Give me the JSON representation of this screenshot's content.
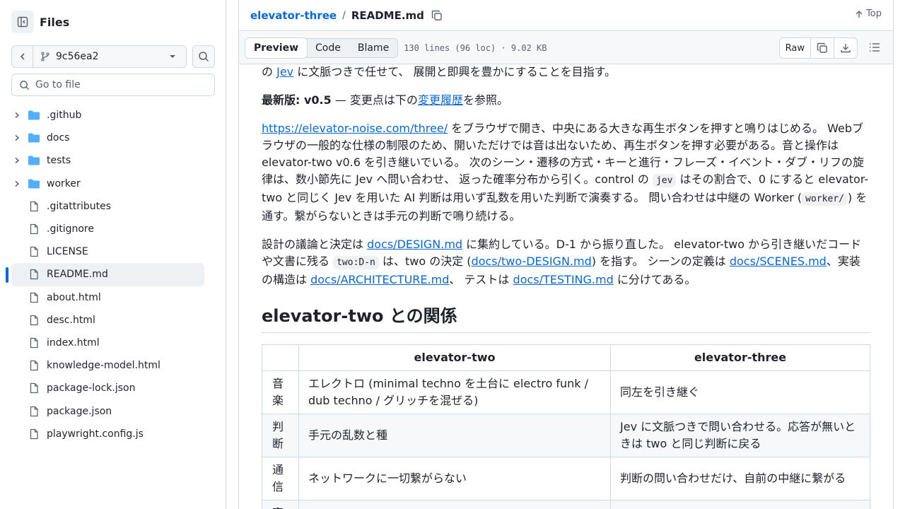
{
  "sidebar": {
    "title": "Files",
    "branch": "9c56ea2",
    "goto_placeholder": "Go to file",
    "items": [
      {
        "type": "dir",
        "label": ".github"
      },
      {
        "type": "dir",
        "label": "docs"
      },
      {
        "type": "dir",
        "label": "tests"
      },
      {
        "type": "dir",
        "label": "worker"
      },
      {
        "type": "file",
        "label": ".gitattributes"
      },
      {
        "type": "file",
        "label": ".gitignore"
      },
      {
        "type": "file",
        "label": "LICENSE"
      },
      {
        "type": "file",
        "label": "README.md",
        "selected": true
      },
      {
        "type": "file",
        "label": "about.html"
      },
      {
        "type": "file",
        "label": "desc.html"
      },
      {
        "type": "file",
        "label": "index.html"
      },
      {
        "type": "file",
        "label": "knowledge-model.html"
      },
      {
        "type": "file",
        "label": "package-lock.json"
      },
      {
        "type": "file",
        "label": "package.json"
      },
      {
        "type": "file",
        "label": "playwright.config.js"
      }
    ]
  },
  "header": {
    "repo": "elevator-three",
    "sep": "/",
    "file": "README.md",
    "top_label": "Top"
  },
  "toolbar": {
    "tabs": [
      "Preview",
      "Code",
      "Blame"
    ],
    "meta": "130 lines (96 loc) · 9.02 KB",
    "raw_label": "Raw"
  },
  "content": {
    "p0": {
      "pre": "の ",
      "link": "Jev",
      "post": " に文脈つきで任せて、 展開と即興を豊かにすることを目指す。"
    },
    "p1": {
      "bold": "最新版: v0.5",
      "mid": " — 変更点は下の",
      "link": "変更履歴",
      "post": "を参照。"
    },
    "p2": {
      "link": "https://elevator-noise.com/three/",
      "t1": " をブラウザで開き、中央にある大きな再生ボタンを押すと鳴りはじめる。 Webブラウザの一般的な仕様の制限のため、開いただけでは音は出ないため、再生ボタンを押す必要がある。音と操作は elevator-two v0.6 を引き継いでいる。 次のシーン・遷移の方式・キーと進行・フレーズ・イベント・ダブ・リフの旋律は、数小節先に Jev へ問い合わせ、 返った確率分布から引く。control の ",
      "code1": "jev",
      "t2": " はその割合で、0 にすると elevator-two と同じく Jev を用いた AI 判断は用いず乱数を用いた判断で演奏する。 問い合わせは中継の Worker (",
      "code2": "worker/",
      "t3": ") を通す。繋がらないときは手元の判断で鳴り続ける。"
    },
    "p3": {
      "t1": "設計の議論と決定は ",
      "l1": "docs/DESIGN.md",
      "t2": " に集約している。D-1 から振り直した。 elevator-two から引き継いだコードや文書に残る ",
      "code": "two:D-n",
      "t3": " は、two の決定 (",
      "l2": "docs/two-DESIGN.md",
      "t4": ") を指す。 シーンの定義は ",
      "l3": "docs/SCENES.md",
      "t5": "、実装の構造は ",
      "l4": "docs/ARCHITECTURE.md",
      "t6": "、 テストは ",
      "l5": "docs/TESTING.md",
      "t7": " に分けてある。"
    },
    "h2": "elevator-two との関係",
    "table": {
      "headers": [
        "",
        "elevator-two",
        "elevator-three"
      ],
      "rows": [
        [
          "音楽",
          "エレクトロ (minimal techno を土台に electro funk / dub techno / グリッチを混ぜる)",
          "同左を引き継ぐ"
        ],
        [
          "判断",
          "手元の乱数と種",
          "Jev に文脈つきで問い合わせる。応答が無いときは two と同じ判断に戻る"
        ],
        [
          "通信",
          "ネットワークに一切繋がらない",
          "判断の問い合わせだけ、自前の中継に繋がる"
        ],
        [
          "実",
          "",
          ""
        ]
      ]
    }
  }
}
